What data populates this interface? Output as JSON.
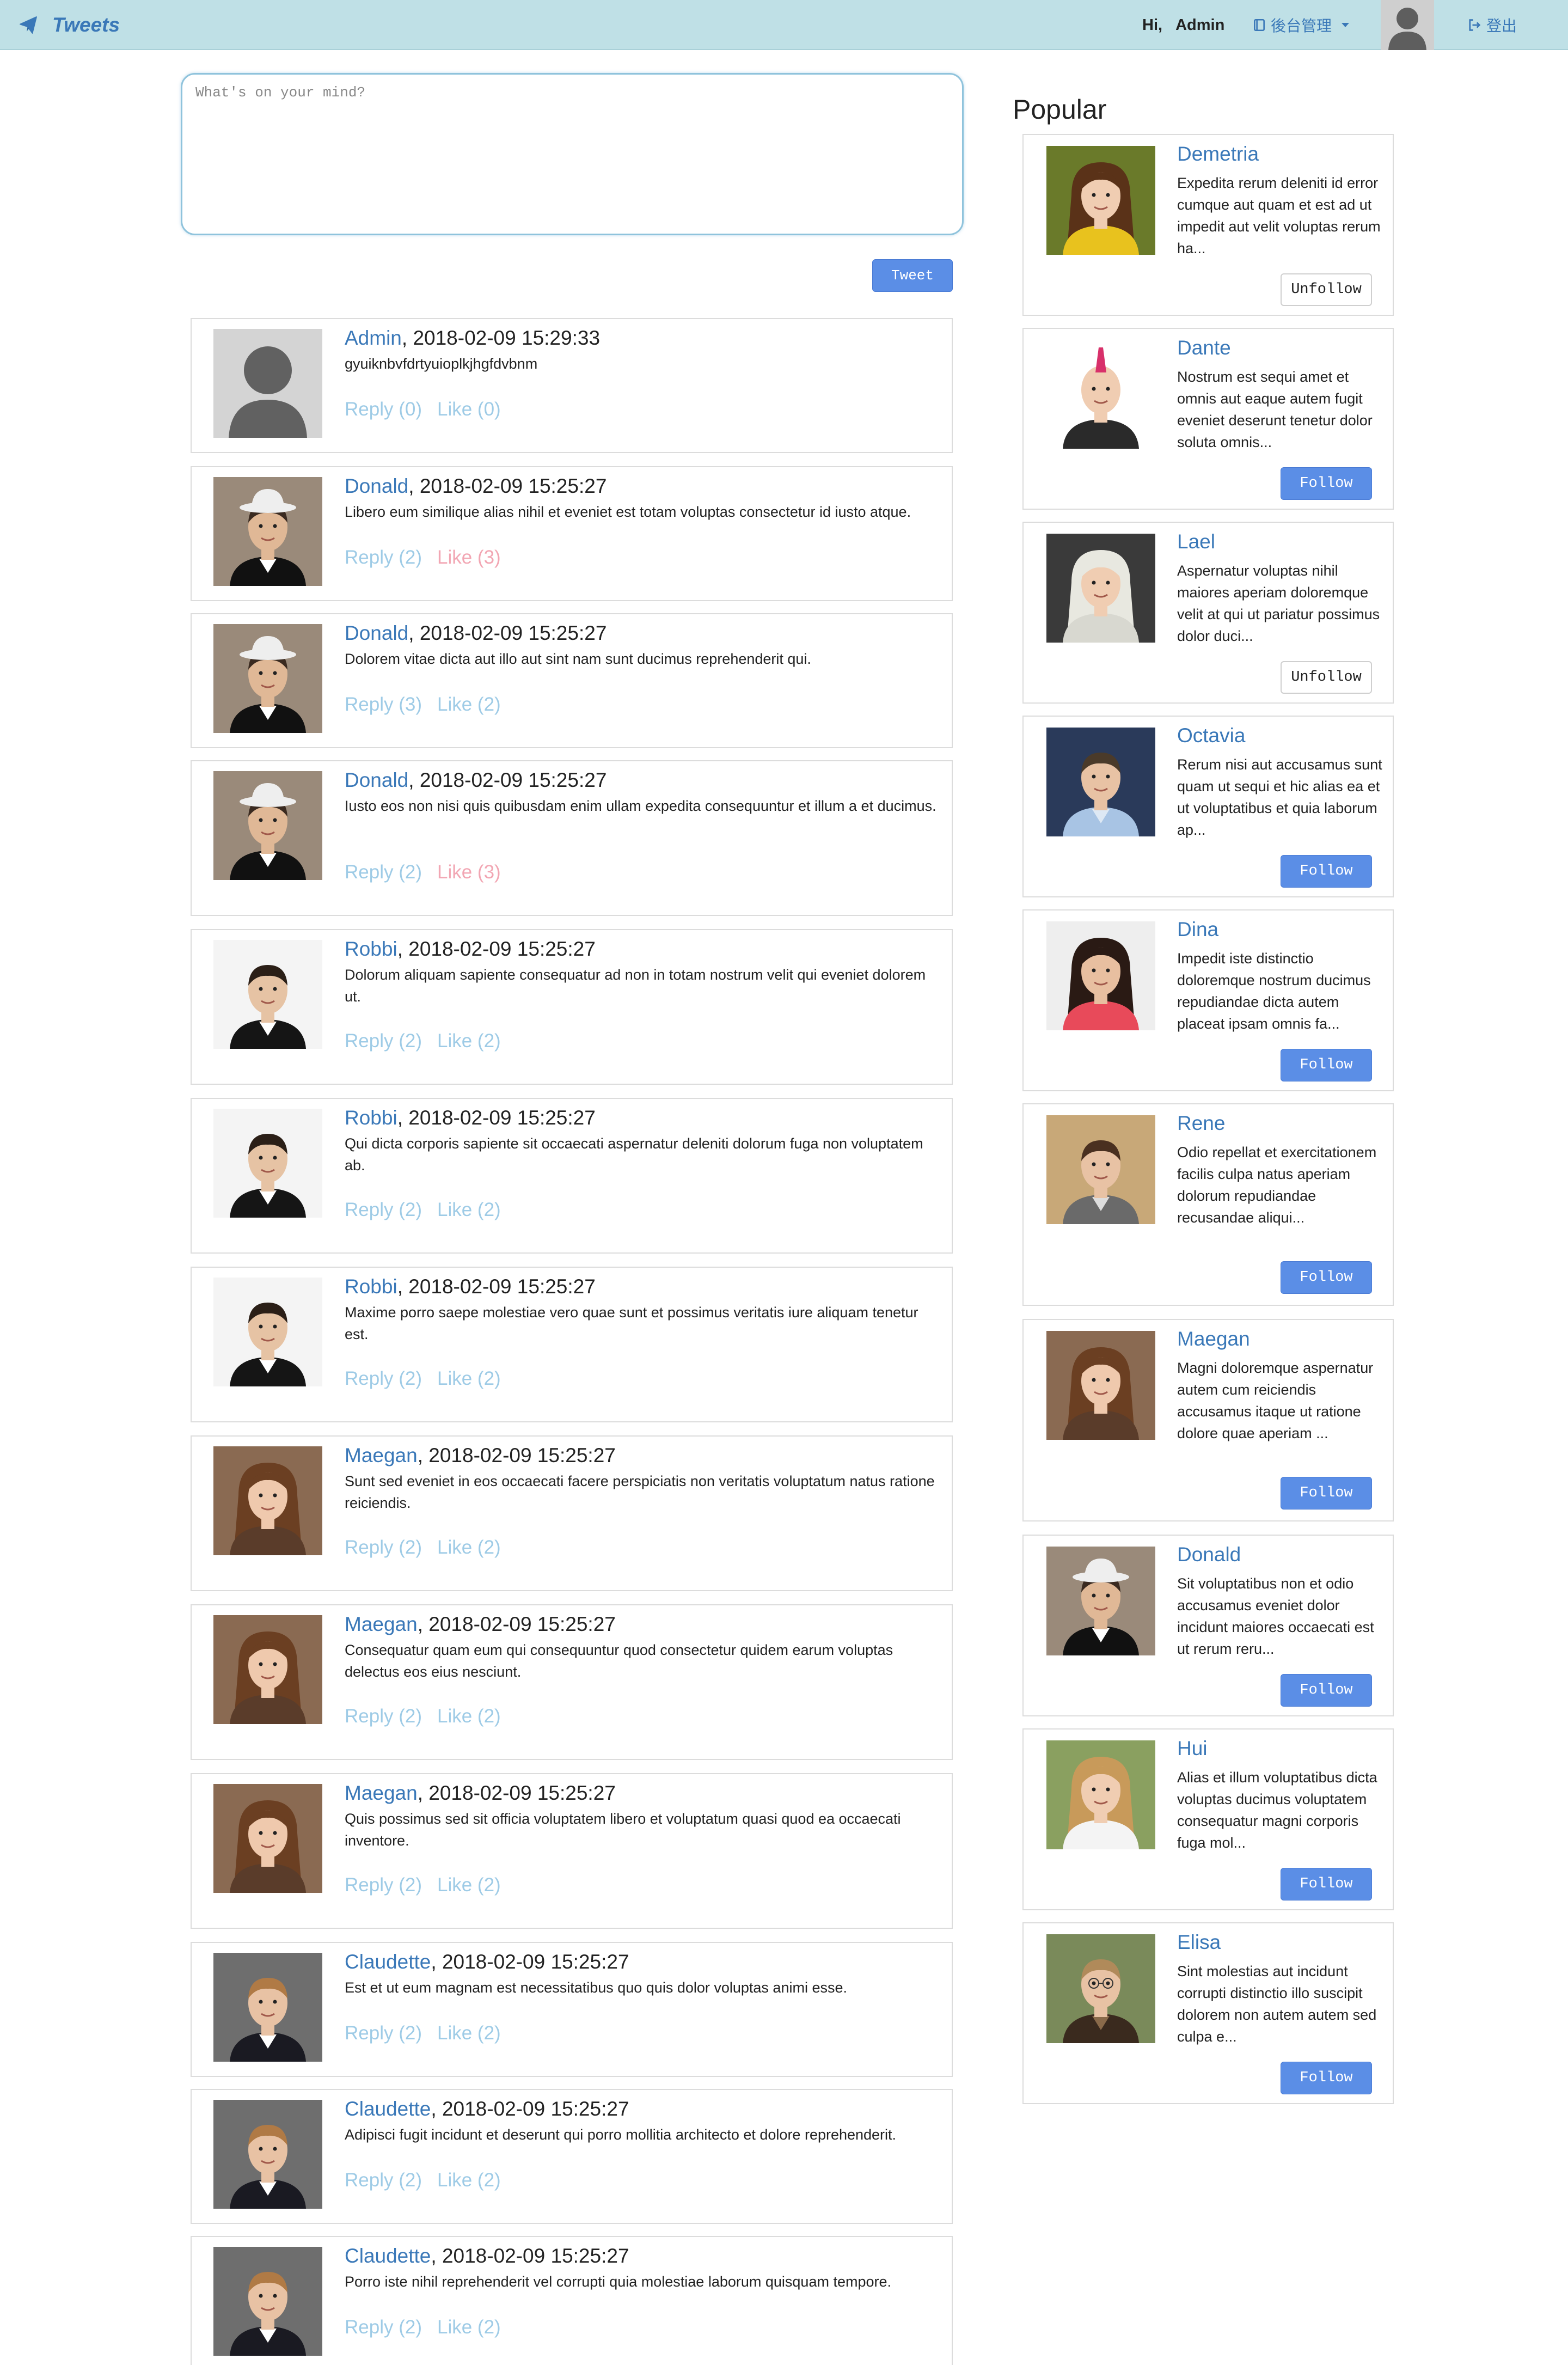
{
  "navbar": {
    "brand": "Tweets",
    "greeting": "Hi,",
    "username": "Admin",
    "admin_menu": "後台管理",
    "logout": "登出"
  },
  "composer": {
    "placeholder": "What's on your mind?",
    "submit_label": "Tweet"
  },
  "feed": [
    {
      "author": "Admin",
      "timestamp": ", 2018-02-09 15:29:33",
      "text": "gyuiknbvfdrtyuioplkjhgfdvbnm",
      "reply": "Reply (0)",
      "like": "Like (0)",
      "liked": false,
      "avatar": "default"
    },
    {
      "author": "Donald",
      "timestamp": ", 2018-02-09 15:25:27",
      "text": "Libero eum similique alias nihil et eveniet est totam voluptas consectetur id iusto atque.",
      "reply": "Reply (2)",
      "like": "Like (3)",
      "liked": true,
      "avatar": "donald"
    },
    {
      "author": "Donald",
      "timestamp": ", 2018-02-09 15:25:27",
      "text": "Dolorem vitae dicta aut illo aut sint nam sunt ducimus reprehenderit qui.",
      "reply": "Reply (3)",
      "like": "Like (2)",
      "liked": false,
      "avatar": "donald"
    },
    {
      "author": "Donald",
      "timestamp": ", 2018-02-09 15:25:27",
      "text": "Iusto eos non nisi quis quibusdam enim ullam expedita consequuntur et illum a et ducimus.",
      "reply": "Reply (2)",
      "like": "Like (3)",
      "liked": true,
      "avatar": "donald"
    },
    {
      "author": "Robbi",
      "timestamp": ", 2018-02-09 15:25:27",
      "text": "Dolorum aliquam sapiente consequatur ad non in totam nostrum velit qui eveniet dolorem ut.",
      "reply": "Reply (2)",
      "like": "Like (2)",
      "liked": false,
      "avatar": "robbi"
    },
    {
      "author": "Robbi",
      "timestamp": ", 2018-02-09 15:25:27",
      "text": "Qui dicta corporis sapiente sit occaecati aspernatur deleniti dolorum fuga non voluptatem ab.",
      "reply": "Reply (2)",
      "like": "Like (2)",
      "liked": false,
      "avatar": "robbi"
    },
    {
      "author": "Robbi",
      "timestamp": ", 2018-02-09 15:25:27",
      "text": "Maxime porro saepe molestiae vero quae sunt et possimus veritatis iure aliquam tenetur est.",
      "reply": "Reply (2)",
      "like": "Like (2)",
      "liked": false,
      "avatar": "robbi"
    },
    {
      "author": "Maegan",
      "timestamp": ", 2018-02-09 15:25:27",
      "text": "Sunt sed eveniet in eos occaecati facere perspiciatis non veritatis voluptatum natus ratione reiciendis.",
      "reply": "Reply (2)",
      "like": "Like (2)",
      "liked": false,
      "avatar": "maegan"
    },
    {
      "author": "Maegan",
      "timestamp": ", 2018-02-09 15:25:27",
      "text": "Consequatur quam eum qui consequuntur quod consectetur quidem earum voluptas delectus eos eius nesciunt.",
      "reply": "Reply (2)",
      "like": "Like (2)",
      "liked": false,
      "avatar": "maegan"
    },
    {
      "author": "Maegan",
      "timestamp": ", 2018-02-09 15:25:27",
      "text": "Quis possimus sed sit officia voluptatem libero et voluptatum quasi quod ea occaecati inventore.",
      "reply": "Reply (2)",
      "like": "Like (2)",
      "liked": false,
      "avatar": "maegan"
    },
    {
      "author": "Claudette",
      "timestamp": ", 2018-02-09 15:25:27",
      "text": "Est et ut eum magnam est necessitatibus quo quis dolor voluptas animi esse.",
      "reply": "Reply (2)",
      "like": "Like (2)",
      "liked": false,
      "avatar": "claudette"
    },
    {
      "author": "Claudette",
      "timestamp": ", 2018-02-09 15:25:27",
      "text": "Adipisci fugit incidunt et deserunt qui porro mollitia architecto et dolore reprehenderit.",
      "reply": "Reply (2)",
      "like": "Like (2)",
      "liked": false,
      "avatar": "claudette"
    },
    {
      "author": "Claudette",
      "timestamp": ", 2018-02-09 15:25:27",
      "text": "Porro iste nihil reprehenderit vel corrupti quia molestiae laborum quisquam tempore.",
      "reply": "Reply (2)",
      "like": "Like (2)",
      "liked": false,
      "avatar": "claudette"
    }
  ],
  "popular": {
    "title": "Popular",
    "users": [
      {
        "name": "Demetria",
        "bio": "Expedita rerum deleniti id error cumque aut quam et est ad ut impedit aut velit voluptas rerum ha...",
        "button": "Unfollow",
        "following": true,
        "avatar": "demetria"
      },
      {
        "name": "Dante",
        "bio": "Nostrum est sequi amet et omnis aut eaque autem fugit eveniet deserunt tenetur dolor soluta omnis...",
        "button": "Follow",
        "following": false,
        "avatar": "dante"
      },
      {
        "name": "Lael",
        "bio": "Aspernatur voluptas nihil maiores aperiam doloremque velit at qui ut pariatur possimus dolor duci...",
        "button": "Unfollow",
        "following": true,
        "avatar": "lael"
      },
      {
        "name": "Octavia",
        "bio": "Rerum nisi aut accusamus sunt quam ut sequi et hic alias ea et ut voluptatibus et quia laborum ap...",
        "button": "Follow",
        "following": false,
        "avatar": "octavia"
      },
      {
        "name": "Dina",
        "bio": "Impedit iste distinctio doloremque nostrum ducimus repudiandae dicta autem placeat ipsam omnis fa...",
        "button": "Follow",
        "following": false,
        "avatar": "dina"
      },
      {
        "name": "Rene",
        "bio": "Odio repellat et exercitationem facilis culpa natus aperiam dolorum repudiandae recusandae aliqui...",
        "button": "Follow",
        "following": false,
        "avatar": "rene"
      },
      {
        "name": "Maegan",
        "bio": "Magni doloremque aspernatur autem cum reiciendis accusamus itaque ut ratione dolore quae aperiam ...",
        "button": "Follow",
        "following": false,
        "avatar": "maegan"
      },
      {
        "name": "Donald",
        "bio": "Sit voluptatibus non et odio accusamus eveniet dolor incidunt maiores occaecati est ut rerum reru...",
        "button": "Follow",
        "following": false,
        "avatar": "donald"
      },
      {
        "name": "Hui",
        "bio": "Alias et illum voluptatibus dicta voluptas ducimus voluptatem consequatur magni corporis fuga mol...",
        "button": "Follow",
        "following": false,
        "avatar": "hui"
      },
      {
        "name": "Elisa",
        "bio": "Sint molestias aut incidunt corrupti distinctio illo suscipit dolorem non autem autem sed culpa e...",
        "button": "Follow",
        "following": false,
        "avatar": "elisa"
      }
    ]
  },
  "colors": {
    "navbar_bg": "#bfe0e6",
    "link": "#3a78b8",
    "action": "#9ecbe6",
    "liked": "#f2a6b3",
    "button": "#5b8ee6"
  }
}
